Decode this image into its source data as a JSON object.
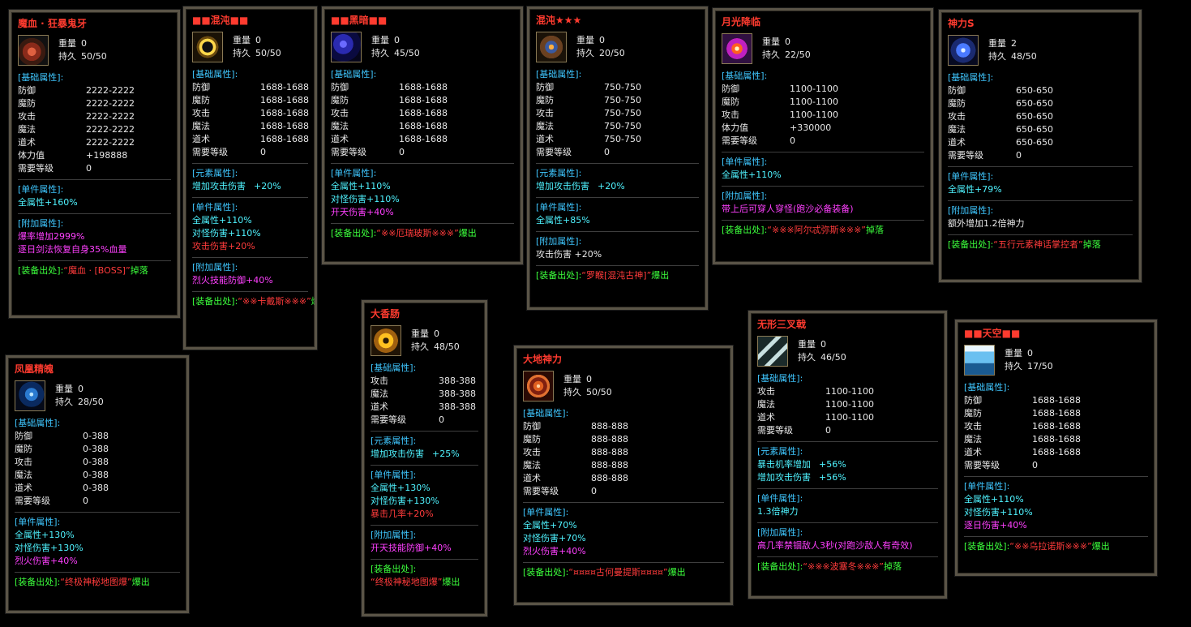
{
  "labels": {
    "weight": "重量",
    "durability": "持久",
    "base": "[基础属性]:",
    "element": "[元素属性]:",
    "single": "[单件属性]:",
    "extra": "[附加属性]:",
    "source": "[装备出处]:"
  },
  "items": [
    {
      "id": "mozue",
      "title": "魔血 · 狂暴鬼牙",
      "icon": "beast-claw-icon",
      "weight": "0",
      "durability": "50/50",
      "base": [
        [
          "防御",
          "2222-2222"
        ],
        [
          "魔防",
          "2222-2222"
        ],
        [
          "攻击",
          "2222-2222"
        ],
        [
          "魔法",
          "2222-2222"
        ],
        [
          "道术",
          "2222-2222"
        ],
        [
          "体力值",
          "+198888"
        ],
        [
          "需要等级",
          "0"
        ]
      ],
      "single": [
        "全属性+160%"
      ],
      "extra": [
        "爆率增加2999%",
        "逐日剑法恢复自身35%血量"
      ],
      "source_name": "“魔血 · [BOSS]”",
      "source_how": "掉落"
    },
    {
      "id": "hundun1",
      "title": "■■混沌■■",
      "icon": "golden-ring-icon",
      "weight": "0",
      "durability": "50/50",
      "base": [
        [
          "防御",
          "1688-1688"
        ],
        [
          "魔防",
          "1688-1688"
        ],
        [
          "攻击",
          "1688-1688"
        ],
        [
          "魔法",
          "1688-1688"
        ],
        [
          "道术",
          "1688-1688"
        ],
        [
          "需要等级",
          "0"
        ]
      ],
      "element": [
        [
          "增加攻击伤害",
          "+20%"
        ]
      ],
      "single": [
        "全属性+110%",
        "对怪伤害+110%",
        "攻击伤害+20%"
      ],
      "extra": [
        "烈火技能防御+40%"
      ],
      "source_name": "“※※卡戴斯※※※”",
      "source_how": "爆出"
    },
    {
      "id": "heian",
      "title": "■■黑暗■■",
      "icon": "dark-orb-icon",
      "weight": "0",
      "durability": "45/50",
      "base": [
        [
          "防御",
          "1688-1688"
        ],
        [
          "魔防",
          "1688-1688"
        ],
        [
          "攻击",
          "1688-1688"
        ],
        [
          "魔法",
          "1688-1688"
        ],
        [
          "道术",
          "1688-1688"
        ],
        [
          "需要等级",
          "0"
        ]
      ],
      "single": [
        "全属性+110%",
        "对怪伤害+110%",
        "开天伤害+40%"
      ],
      "source_name": "“※※厄瑞玻斯※※※”",
      "source_how": "爆出"
    },
    {
      "id": "hundun3",
      "title": "混沌★★★",
      "icon": "bracer-icon",
      "weight": "0",
      "durability": "20/50",
      "base": [
        [
          "防御",
          "750-750"
        ],
        [
          "魔防",
          "750-750"
        ],
        [
          "攻击",
          "750-750"
        ],
        [
          "魔法",
          "750-750"
        ],
        [
          "道术",
          "750-750"
        ],
        [
          "需要等级",
          "0"
        ]
      ],
      "element": [
        [
          "增加攻击伤害",
          "+20%"
        ]
      ],
      "single": [
        "全属性+85%"
      ],
      "extra": [
        "攻击伤害 +20%"
      ],
      "source_name": "“罗睺[混沌古神]”",
      "source_how": "爆出"
    },
    {
      "id": "yueguang",
      "title": "月光降临",
      "icon": "moonlight-orb-icon",
      "weight": "0",
      "durability": "22/50",
      "base": [
        [
          "防御",
          "1100-1100"
        ],
        [
          "魔防",
          "1100-1100"
        ],
        [
          "攻击",
          "1100-1100"
        ],
        [
          "体力值",
          "+330000"
        ],
        [
          "需要等级",
          "0"
        ]
      ],
      "single": [
        "全属性+110%"
      ],
      "extra": [
        "带上后可穿人穿怪(跑沙必备装备)"
      ],
      "source_name": "“※※※阿尔忒弥斯※※※”",
      "source_how": "掉落"
    },
    {
      "id": "shenli",
      "title": "神力S",
      "icon": "winged-emblem-icon",
      "weight": "2",
      "durability": "48/50",
      "base": [
        [
          "防御",
          "650-650"
        ],
        [
          "魔防",
          "650-650"
        ],
        [
          "攻击",
          "650-650"
        ],
        [
          "魔法",
          "650-650"
        ],
        [
          "道术",
          "650-650"
        ],
        [
          "需要等级",
          "0"
        ]
      ],
      "single": [
        "全属性+79%"
      ],
      "extra": [
        "额外增加1.2倍神力"
      ],
      "source_name": "“五行元素神话掌控者”",
      "source_how": "掉落"
    },
    {
      "id": "fenghuang",
      "title": "凤凰精魄",
      "icon": "phoenix-spirit-icon",
      "weight": "0",
      "durability": "28/50",
      "base": [
        [
          "防御",
          "0-388"
        ],
        [
          "魔防",
          "0-388"
        ],
        [
          "攻击",
          "0-388"
        ],
        [
          "魔法",
          "0-388"
        ],
        [
          "道术",
          "0-388"
        ],
        [
          "需要等级",
          "0"
        ]
      ],
      "single": [
        "全属性+130%",
        "对怪伤害+130%",
        "烈火伤害+40%"
      ],
      "source_name": "“终极神秘地图爆”",
      "source_how": "爆出"
    },
    {
      "id": "daxiangchang",
      "title": "大香肠",
      "icon": "golden-rune-icon",
      "weight": "0",
      "durability": "48/50",
      "base": [
        [
          "攻击",
          "388-388"
        ],
        [
          "魔法",
          "388-388"
        ],
        [
          "道术",
          "388-388"
        ],
        [
          "需要等级",
          "0"
        ]
      ],
      "element": [
        [
          "增加攻击伤害",
          "+25%"
        ]
      ],
      "single": [
        "全属性+130%",
        "对怪伤害+130%",
        "暴击几率+20%"
      ],
      "extra": [
        "开天技能防御+40%"
      ],
      "source_name": "“终极神秘地图爆”",
      "source_how": "爆出",
      "source_wrap": true
    },
    {
      "id": "dadi",
      "title": "大地神力",
      "icon": "earth-swirl-icon",
      "weight": "0",
      "durability": "50/50",
      "base": [
        [
          "防御",
          "888-888"
        ],
        [
          "魔防",
          "888-888"
        ],
        [
          "攻击",
          "888-888"
        ],
        [
          "魔法",
          "888-888"
        ],
        [
          "道术",
          "888-888"
        ],
        [
          "需要等级",
          "0"
        ]
      ],
      "single": [
        "全属性+70%",
        "对怪伤害+70%",
        "烈火伤害+40%"
      ],
      "source_name": "“¤¤¤¤古何曼提斯¤¤¤¤”",
      "source_how": "爆出"
    },
    {
      "id": "wuxing",
      "title": "无形三叉戟",
      "icon": "trident-icon",
      "weight": "0",
      "durability": "46/50",
      "base": [
        [
          "攻击",
          "1100-1100"
        ],
        [
          "魔法",
          "1100-1100"
        ],
        [
          "道术",
          "1100-1100"
        ],
        [
          "需要等级",
          "0"
        ]
      ],
      "element": [
        [
          "暴击机率增加",
          "+56%"
        ],
        [
          "增加攻击伤害",
          "+56%"
        ]
      ],
      "single": [
        "1.3倍神力"
      ],
      "extra": [
        "高几率禁锢敌人3秒(对跑沙敌人有奇效)"
      ],
      "source_name": "“※※※波塞冬※※※”",
      "source_how": "掉落"
    },
    {
      "id": "tiankong",
      "title": "■■天空■■",
      "icon": "sky-curtain-icon",
      "weight": "0",
      "durability": "17/50",
      "base": [
        [
          "防御",
          "1688-1688"
        ],
        [
          "魔防",
          "1688-1688"
        ],
        [
          "攻击",
          "1688-1688"
        ],
        [
          "魔法",
          "1688-1688"
        ],
        [
          "道术",
          "1688-1688"
        ],
        [
          "需要等级",
          "0"
        ]
      ],
      "single": [
        "全属性+110%",
        "对怪伤害+110%",
        "逐日伤害+40%"
      ],
      "source_name": "“※※乌拉诺斯※※※”",
      "source_how": "爆出"
    }
  ]
}
